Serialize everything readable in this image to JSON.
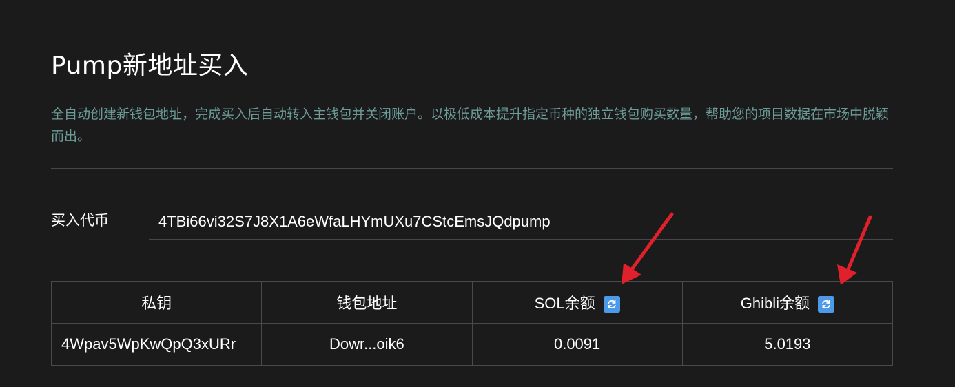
{
  "page": {
    "title": "Pump新地址买入",
    "description": "全自动创建新钱包地址，完成买入后自动转入主钱包并关闭账户。以极低成本提升指定币种的独立钱包购买数量，帮助您的项目数据在市场中脱颖而出。"
  },
  "form": {
    "token_label": "买入代币",
    "token_value": "4TBi66vi32S7J8X1A6eWfaLHYmUXu7CStcEmsJQdpump"
  },
  "table": {
    "headers": {
      "private_key": "私钥",
      "wallet_address": "钱包地址",
      "sol_balance": "SOL余额",
      "token_balance": "Ghibli余额"
    },
    "rows": [
      {
        "private_key": "4Wpav5WpKwQpQ3xURr",
        "wallet_address": "Dowr...oik6",
        "sol_balance": "0.0091",
        "token_balance": "5.0193"
      }
    ]
  },
  "icons": {
    "refresh": "refresh-icon"
  },
  "colors": {
    "background": "#1b1b1c",
    "description_text": "#6b9c98",
    "refresh_icon": "#4d9be8",
    "annotation_arrow": "#e0202a"
  }
}
